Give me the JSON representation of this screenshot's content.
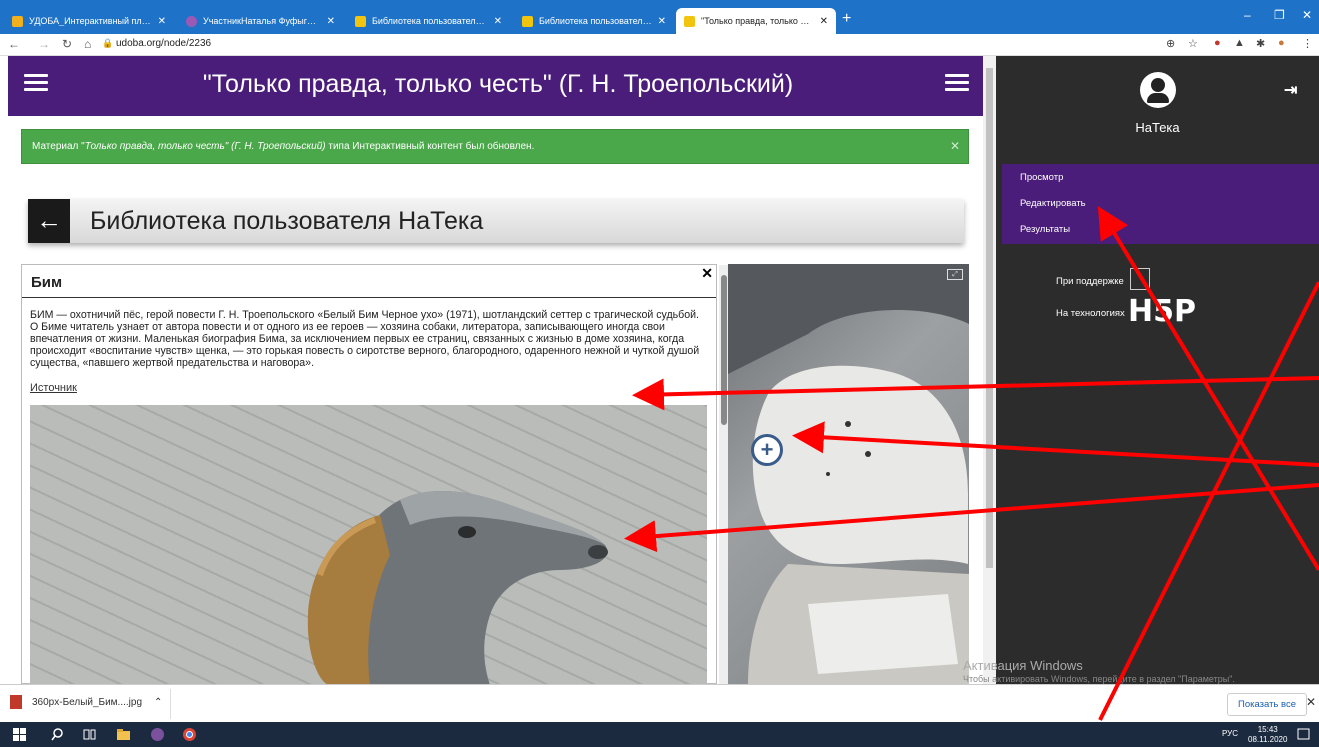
{
  "browser": {
    "tabs": [
      {
        "title": "УДОБА_Интерактивный плакат"
      },
      {
        "title": "УчастникНаталья Фуфыгина –"
      },
      {
        "title": "Библиотека пользователя НаТе"
      },
      {
        "title": "Библиотека пользователя НаТе"
      },
      {
        "title": "\"Только правда, только честь\" ("
      }
    ],
    "url": "udoba.org/node/2236"
  },
  "header": {
    "title": "\"Только правда, только честь\" (Г. Н. Троепольский)"
  },
  "status_message": {
    "prefix": "Материал \"",
    "italic": "Только правда, только честь\" (Г. Н. Троепольский)",
    "suffix": " типа Интерактивный контент был обновлен."
  },
  "library": {
    "title": "Библиотека пользователя НаТека"
  },
  "panel": {
    "heading": "Бим",
    "description": "БИМ — охотничий пёс, герой повести Г. Н. Троепольского «Белый Бим Черное ухо» (1971), шотландский сеттер с трагической судьбой. О Биме читатель узнает от автора повести и от одного из ее героев — хозяина собаки, литератора, записывающего иногда свои впечатления от жизни. Маленькая биография Бима, за исключением первых ее страниц, связанных с жизнью в доме хозяина, когда происходит «воспитание чувств» щенка, — это горькая повесть о сиротстве верного, благородного, одаренного нежной и чуткой душой существа, «павшего жертвой предательства и наговора».",
    "source_link": "Источник"
  },
  "sidebar": {
    "username": "НаТека",
    "menu": [
      {
        "label": "Просмотр"
      },
      {
        "label": "Редактировать"
      },
      {
        "label": "Результаты"
      }
    ],
    "supported_by": "При поддержке",
    "technologies": "На технологиях",
    "h5p_logo": "H5P"
  },
  "watermark": {
    "line1": "Активация Windows",
    "line2": "Чтобы активировать Windows, перейдите в раздел \"Параметры\"."
  },
  "downloads": {
    "file": "360px-Белый_Бим....jpg",
    "show_all": "Показать все"
  },
  "taskbar": {
    "lang": "РУС",
    "time": "15:43",
    "date": "08.11.2020"
  },
  "colors": {
    "header_purple": "#4b1d7a",
    "message_green": "#4aa84a",
    "tab_blue": "#1e73c8",
    "arrow_red": "#ff0000"
  }
}
